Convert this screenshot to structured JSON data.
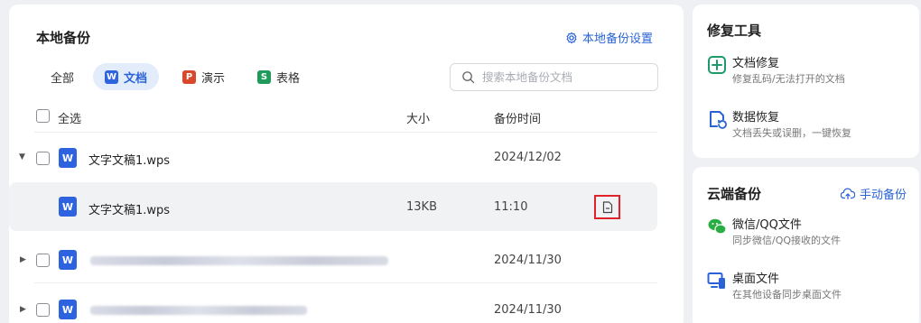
{
  "main": {
    "title": "本地备份",
    "settings_link": "本地备份设置",
    "tabs": [
      {
        "label": "全部",
        "badge": ""
      },
      {
        "label": "文档",
        "badge": "W",
        "color": "#2e63e0"
      },
      {
        "label": "演示",
        "badge": "P",
        "color": "#d9482b"
      },
      {
        "label": "表格",
        "badge": "S",
        "color": "#1e9a5a"
      }
    ],
    "search": {
      "placeholder": "搜索本地备份文档"
    },
    "columns": {
      "select_all": "全选",
      "size": "大小",
      "time": "备份时间"
    },
    "rows": [
      {
        "name": "文字文稿1.wps",
        "size": "",
        "time": "2024/12/02",
        "expanded": true
      },
      {
        "name": "文字文稿1.wps",
        "size": "13KB",
        "time": "11:10",
        "child": true
      },
      {
        "name": "",
        "size": "",
        "time": "2024/11/30"
      },
      {
        "name": "",
        "size": "",
        "time": "2024/11/30"
      }
    ]
  },
  "repair": {
    "title": "修复工具",
    "items": [
      {
        "label": "文档修复",
        "desc": "修复乱码/无法打开的文档"
      },
      {
        "label": "数据恢复",
        "desc": "文档丢失或误删，一键恢复"
      }
    ]
  },
  "cloud": {
    "title": "云端备份",
    "manual_link": "手动备份",
    "items": [
      {
        "label": "微信/QQ文件",
        "desc": "同步微信/QQ接收的文件"
      },
      {
        "label": "桌面文件",
        "desc": "在其他设备同步桌面文件"
      }
    ]
  },
  "colors": {
    "accent": "#2a63d6",
    "tool_green": "#1e9a6a",
    "highlight_red": "#e0232b"
  }
}
